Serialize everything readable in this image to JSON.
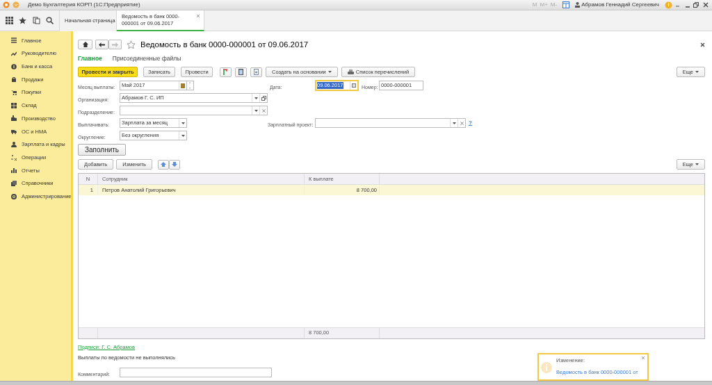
{
  "window": {
    "title": "Демо Бухгалтерия КОРП  (1С:Предприятие)",
    "memory_buttons": [
      "M",
      "M+",
      "M-"
    ],
    "user": "Абрамов Геннадий Сергеевич"
  },
  "tabs": [
    {
      "label": "Начальная страница",
      "selected": false
    },
    {
      "label": "Ведомость в банк 0000-000001 от 09.06.2017",
      "selected": true
    }
  ],
  "sidebar": {
    "items": [
      {
        "label": "Главное"
      },
      {
        "label": "Руководителю"
      },
      {
        "label": "Банк и касса"
      },
      {
        "label": "Продажи"
      },
      {
        "label": "Покупки"
      },
      {
        "label": "Склад"
      },
      {
        "label": "Производство"
      },
      {
        "label": "ОС и НМА"
      },
      {
        "label": "Зарплата и кадры"
      },
      {
        "label": "Операции"
      },
      {
        "label": "Отчеты"
      },
      {
        "label": "Справочники"
      },
      {
        "label": "Администрирование"
      }
    ]
  },
  "document": {
    "title": "Ведомость в банк 0000-000001 от 09.06.2017",
    "form_tabs": [
      {
        "label": "Главное",
        "selected": true
      },
      {
        "label": "Присоединенные файлы",
        "selected": false
      }
    ],
    "toolbar": {
      "primary": "Провести и закрыть",
      "buttons": [
        "Записать",
        "Провести"
      ],
      "create_based": "Создать на основании",
      "print": "Список перечислений",
      "more": "Еще"
    },
    "fields": {
      "month": {
        "label": "Месяц выплаты:",
        "value": "Май 2017"
      },
      "date": {
        "label": "Дата:",
        "value": "09.06.2017"
      },
      "number": {
        "label": "Номер:",
        "value": "0000-000001"
      },
      "organization": {
        "label": "Организация:",
        "value": "Абрамов Г. С. ИП"
      },
      "department": {
        "label": "Подразделение:"
      },
      "pay": {
        "label": "Выплачивать:",
        "value": "Зарплата за месяц"
      },
      "salary_project": {
        "label": "Зарплатный проект:",
        "help": "?"
      },
      "rounding": {
        "label": "Округление:",
        "value": "Без округления"
      }
    },
    "fill_button": "Заполнить",
    "table_toolbar": {
      "buttons": [
        "Добавить",
        "Изменить"
      ],
      "more": "Еще"
    },
    "table": {
      "columns": [
        "N",
        "Сотрудник",
        "К выплате"
      ],
      "rows": [
        {
          "n": "1",
          "employee": "Петров Анатолий Григорьевич",
          "amount": "8 700,00",
          "selected": true
        }
      ],
      "footer_total": "8 700,00"
    },
    "signatures": "Подписи: Г. С. Абрамов",
    "note": "Выплаты по ведомости не выполнялись",
    "comment": {
      "label": "Комментарий:"
    }
  },
  "notification": {
    "title": "Изменение:",
    "link": "Ведомость в банк 0000-000001 от"
  }
}
